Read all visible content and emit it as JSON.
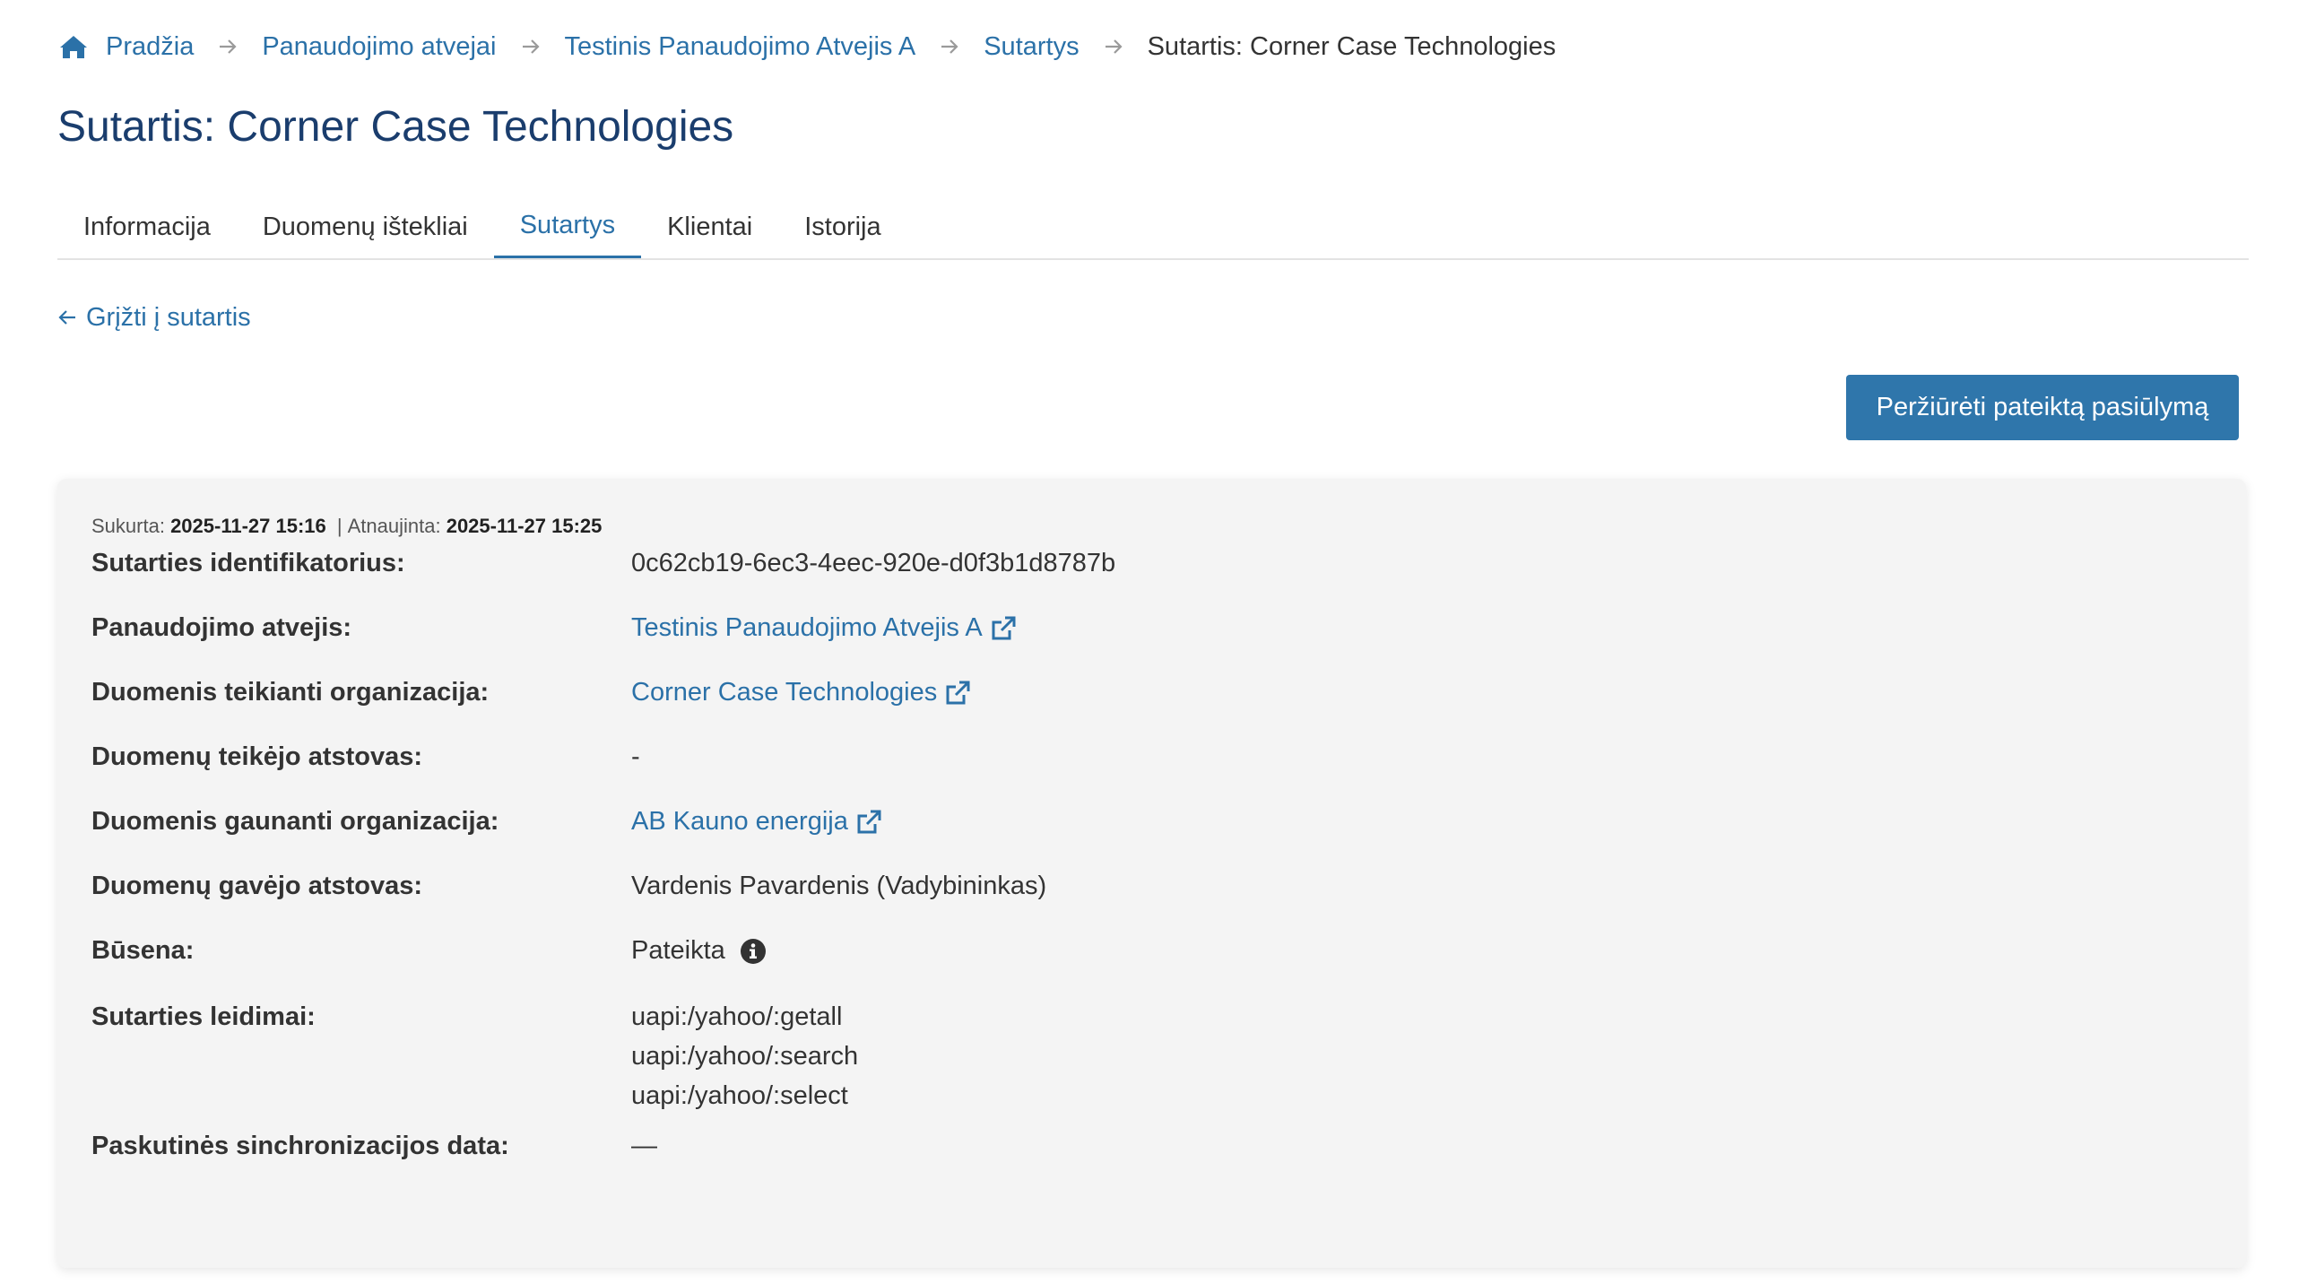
{
  "breadcrumb": {
    "items": [
      {
        "label": "Pradžia"
      },
      {
        "label": "Panaudojimo atvejai"
      },
      {
        "label": "Testinis Panaudojimo Atvejis A"
      },
      {
        "label": "Sutartys"
      }
    ],
    "current": "Sutartis: Corner Case Technologies"
  },
  "page_title": "Sutartis: Corner Case Technologies",
  "tabs": [
    {
      "label": "Informacija"
    },
    {
      "label": "Duomenų ištekliai"
    },
    {
      "label": "Sutartys",
      "active": true
    },
    {
      "label": "Klientai"
    },
    {
      "label": "Istorija"
    }
  ],
  "back_link": "Grįžti į sutartis",
  "view_offer_button": "Peržiūrėti pateiktą pasiūlymą",
  "meta": {
    "created_label": "Sukurta:",
    "created_value": "2025-11-27 15:16",
    "separator": "|",
    "updated_label": "Atnaujinta:",
    "updated_value": "2025-11-27 15:25"
  },
  "details": {
    "contract_id": {
      "label": "Sutarties identifikatorius:",
      "value": "0c62cb19-6ec3-4eec-920e-d0f3b1d8787b"
    },
    "use_case": {
      "label": "Panaudojimo atvejis:",
      "value": "Testinis Panaudojimo Atvejis A"
    },
    "provider_org": {
      "label": "Duomenis teikianti organizacija:",
      "value": "Corner Case Technologies"
    },
    "provider_rep": {
      "label": "Duomenų teikėjo atstovas:",
      "value": "-"
    },
    "consumer_org": {
      "label": "Duomenis gaunanti organizacija:",
      "value": "AB Kauno energija"
    },
    "consumer_rep": {
      "label": "Duomenų gavėjo atstovas:",
      "value": "Vardenis Pavardenis (Vadybininkas)"
    },
    "status": {
      "label": "Būsena:",
      "value": "Pateikta"
    },
    "permissions": {
      "label": "Sutarties leidimai:",
      "values": [
        "uapi:/yahoo/:getall",
        "uapi:/yahoo/:search",
        "uapi:/yahoo/:select"
      ]
    },
    "last_sync": {
      "label": "Paskutinės sinchronizacijos data:",
      "value": "—"
    }
  },
  "colors": {
    "link": "#2b71a8",
    "title": "#1a3d6d",
    "button_bg": "#2f76ab",
    "card_bg": "#f4f4f4"
  },
  "icons": [
    "home-icon",
    "arrow-right-icon",
    "arrow-left-icon",
    "external-link-icon",
    "info-icon"
  ]
}
